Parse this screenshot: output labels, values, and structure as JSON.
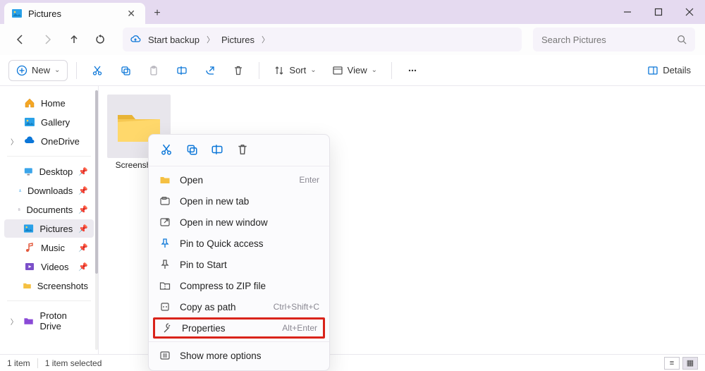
{
  "window": {
    "tab_title": "Pictures"
  },
  "nav": {
    "backup_label": "Start backup",
    "crumbs": [
      "Pictures"
    ],
    "search_placeholder": "Search Pictures"
  },
  "toolbar": {
    "new_label": "New",
    "sort_label": "Sort",
    "view_label": "View",
    "details_label": "Details"
  },
  "sidebar": {
    "top": [
      {
        "label": "Home",
        "icon": "home-icon"
      },
      {
        "label": "Gallery",
        "icon": "gallery-icon"
      },
      {
        "label": "OneDrive",
        "icon": "onedrive-icon",
        "expander": true
      }
    ],
    "quick": [
      {
        "label": "Desktop",
        "icon": "desktop-icon",
        "pin": true
      },
      {
        "label": "Downloads",
        "icon": "downloads-icon",
        "pin": true
      },
      {
        "label": "Documents",
        "icon": "documents-icon",
        "pin": true
      },
      {
        "label": "Pictures",
        "icon": "pictures-icon",
        "pin": true,
        "selected": true
      },
      {
        "label": "Music",
        "icon": "music-icon",
        "pin": true
      },
      {
        "label": "Videos",
        "icon": "videos-icon",
        "pin": true
      },
      {
        "label": "Screenshots",
        "icon": "folder-icon"
      }
    ],
    "bottom": [
      {
        "label": "Proton Drive",
        "icon": "proton-icon",
        "expander": true
      }
    ]
  },
  "content": {
    "folder": {
      "name": "Screenshots"
    }
  },
  "context_menu": {
    "items": [
      {
        "label": "Open",
        "shortcut": "Enter",
        "icon": "open-folder-icon"
      },
      {
        "label": "Open in new tab",
        "icon": "new-tab-icon"
      },
      {
        "label": "Open in new window",
        "icon": "new-window-icon"
      },
      {
        "label": "Pin to Quick access",
        "icon": "pin-icon"
      },
      {
        "label": "Pin to Start",
        "icon": "pin-start-icon"
      },
      {
        "label": "Compress to ZIP file",
        "icon": "zip-icon"
      },
      {
        "label": "Copy as path",
        "shortcut": "Ctrl+Shift+C",
        "icon": "copy-path-icon"
      },
      {
        "label": "Properties",
        "shortcut": "Alt+Enter",
        "icon": "properties-icon",
        "highlighted": true
      },
      {
        "label": "Show more options",
        "icon": "more-options-icon",
        "separated": true
      }
    ]
  },
  "status": {
    "count": "1 item",
    "selected": "1 item selected"
  }
}
